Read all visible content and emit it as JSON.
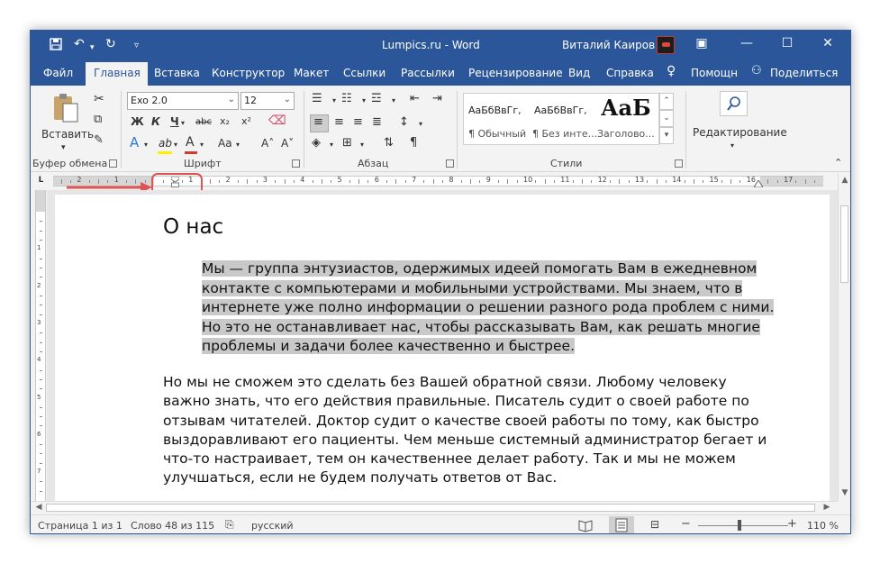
{
  "window": {
    "title": "Lumpics.ru  -  Word",
    "user": "Виталий Каиров",
    "minimize_icon": "minimize-icon",
    "maximize_icon": "maximize-icon",
    "close_icon": "close-icon"
  },
  "quick_access": {
    "save_icon": "save-icon",
    "undo_icon": "undo-icon",
    "redo_icon": "redo-icon",
    "customize_icon": "customize-qat-icon"
  },
  "tabs": [
    "Файл",
    "Главная",
    "Вставка",
    "Конструктор",
    "Макет",
    "Ссылки",
    "Рассылки",
    "Рецензирование",
    "Вид",
    "Справка"
  ],
  "active_tab": "Главная",
  "tell_me": "Помощн",
  "share": "Поделиться",
  "ribbon": {
    "clipboard": {
      "label": "Буфер обмена",
      "paste": "Вставить"
    },
    "font": {
      "label": "Шрифт",
      "font_name": "Exo 2.0",
      "font_size": "12",
      "bold": "Ж",
      "italic": "К",
      "underline": "Ч",
      "strike": "abc",
      "subscript": "x₂",
      "superscript": "x²",
      "text_effects": "A",
      "highlight": "ab",
      "font_color": "A",
      "change_case": "Aa",
      "grow": "A˄",
      "shrink": "A˅",
      "highlight_color": "#ffee00",
      "font_color_value": "#d23b2e"
    },
    "paragraph": {
      "label": "Абзац"
    },
    "styles": {
      "label": "Стили",
      "items": [
        {
          "preview": "АаБбВвГг,",
          "name": "¶ Обычный"
        },
        {
          "preview": "АаБбВвГг,",
          "name": "¶ Без инте..."
        },
        {
          "preview": "АаБ",
          "name": "Заголово..."
        }
      ]
    },
    "editing": {
      "label": "Редактирование"
    }
  },
  "ruler": {
    "tab_selector": "L",
    "numbers": [
      "2",
      "1",
      "1",
      "2",
      "3",
      "4",
      "5",
      "6",
      "7",
      "8",
      "9",
      "10",
      "11",
      "12",
      "13",
      "14",
      "15",
      "16",
      "17"
    ]
  },
  "vertical_ruler": {
    "numbers": [
      "1",
      "2",
      "3",
      "4",
      "5",
      "6",
      "7"
    ]
  },
  "document": {
    "heading": "О нас",
    "selected_paragraph_lines": [
      "Мы — группа энтузиастов, одержимых идеей помогать Вам в ежедневном",
      "контакте с компьютерами и мобильными устройствами. Мы знаем, что в",
      "интернете уже полно информации о решении разного рода проблем с ними.",
      "Но это не останавливает нас, чтобы рассказывать Вам, как решать многие",
      "проблемы и задачи более качественно и быстрее."
    ],
    "paragraph2_lines": [
      "Но мы не сможем это сделать без Вашей обратной связи. Любому человеку",
      "важно знать, что его действия правильные. Писатель судит о своей работе по",
      "отзывам читателей. Доктор судит о качестве своей работы по тому, как быстро",
      "выздоравливают его пациенты. Чем меньше системный администратор бегает и",
      "что-то настраивает, тем он качественнее делает работу. Так и мы не можем",
      "улучшаться, если не будем получать ответов от Вас."
    ]
  },
  "status": {
    "page": "Страница 1 из 1",
    "words": "Слово 48 из 115",
    "language": "русский",
    "zoom_minus": "−",
    "zoom_plus": "+",
    "zoom": "110 %",
    "zoom_level_fraction": 0.44
  },
  "colors": {
    "accent": "#2b579a",
    "annotation": "#e05353",
    "selection": "#c9c9c9"
  }
}
